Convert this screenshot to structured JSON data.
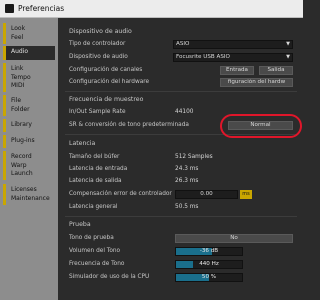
{
  "window": {
    "title": "Preferencias"
  },
  "sidebar": {
    "tabs": [
      {
        "lines": [
          "Look",
          "Feel"
        ],
        "active": false
      },
      {
        "lines": [
          "Audio"
        ],
        "active": true
      },
      {
        "lines": [
          "Link",
          "Tempo",
          "MIDI"
        ],
        "active": false
      },
      {
        "lines": [
          "File",
          "Folder"
        ],
        "active": false
      },
      {
        "lines": [
          "Library"
        ],
        "active": false
      },
      {
        "lines": [
          "Plug-ins"
        ],
        "active": false
      },
      {
        "lines": [
          "Record",
          "Warp",
          "Launch"
        ],
        "active": false
      },
      {
        "lines": [
          "Licenses",
          "Maintenance"
        ],
        "active": false
      }
    ]
  },
  "audio_device": {
    "section": "Dispositivo de audio",
    "driver_type_label": "Tipo de controlador",
    "driver_type_value": "ASIO",
    "device_label": "Dispositivo de audio",
    "device_value": "Focusrite USB ASIO",
    "channel_config_label": "Configuración de canales",
    "input_button": "Entrada",
    "output_button": "Salida",
    "hardware_config_label": "Configuración del hardware",
    "hardware_config_button": "figuración del hardw"
  },
  "sample_rate": {
    "section": "Frecuencia de muestreo",
    "io_rate_label": "In/Out Sample Rate",
    "io_rate_value": "44100",
    "conversion_label": "SR & conversión de tono predeterminada",
    "conversion_value": "Normal"
  },
  "latency": {
    "section": "Latencia",
    "buffer_label": "Tamaño del búfer",
    "buffer_value": "512 Samples",
    "input_label": "Latencia de entrada",
    "input_value": "24.3 ms",
    "output_label": "Latencia de salida",
    "output_value": "26.3 ms",
    "compensation_label": "Compensación error de controlador",
    "compensation_value": "0.00",
    "compensation_unit": "ms",
    "overall_label": "Latencia general",
    "overall_value": "50.5 ms"
  },
  "test": {
    "section": "Prueba",
    "tone_label": "Tono de prueba",
    "tone_value": "No",
    "volume_label": "Volumen del Tono",
    "volume_value": "-36 dB",
    "volume_fill": 0.55,
    "freq_label": "Frecuencia de Tono",
    "freq_value": "440 Hz",
    "freq_fill": 0.25,
    "cpu_label": "Simulador de uso de la CPU",
    "cpu_value": "50 %",
    "cpu_fill": 0.5
  },
  "colors": {
    "accent": "#c9a600",
    "highlight_circle": "#e0162a",
    "meter_fill": "#1a6f8c"
  }
}
